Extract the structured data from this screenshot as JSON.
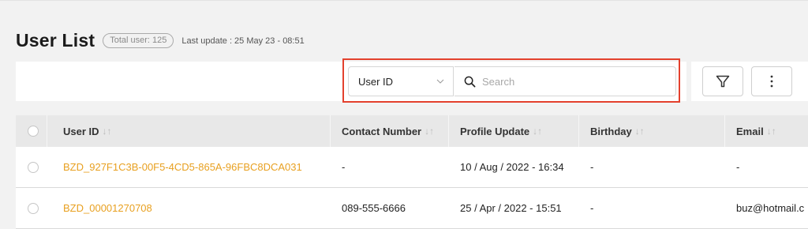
{
  "header": {
    "title": "User List",
    "total_badge": "Total user: 125",
    "last_update": "Last update : 25 May 23 - 08:51"
  },
  "search": {
    "field_selected": "User ID",
    "placeholder": "Search",
    "value": ""
  },
  "icons": {
    "chevron": "chevron-down-icon",
    "search": "search-icon",
    "filter": "filter-icon",
    "more": "more-vertical-icon"
  },
  "colors": {
    "link": "#e8a020",
    "highlight": "#e3412d"
  },
  "table": {
    "sort_glyph": "↓↑",
    "columns": [
      "User ID",
      "Contact Number",
      "Profile Update",
      "Birthday",
      "Email"
    ],
    "rows": [
      {
        "user_id": "BZD_927F1C3B-00F5-4CD5-865A-96FBC8DCA031",
        "contact": "-",
        "profile_update": "10 / Aug / 2022 - 16:34",
        "birthday": "-",
        "email": "-"
      },
      {
        "user_id": "BZD_00001270708",
        "contact": "089-555-6666",
        "profile_update": "25 / Apr / 2022 - 15:51",
        "birthday": "-",
        "email": "buz@hotmail.c"
      }
    ]
  }
}
